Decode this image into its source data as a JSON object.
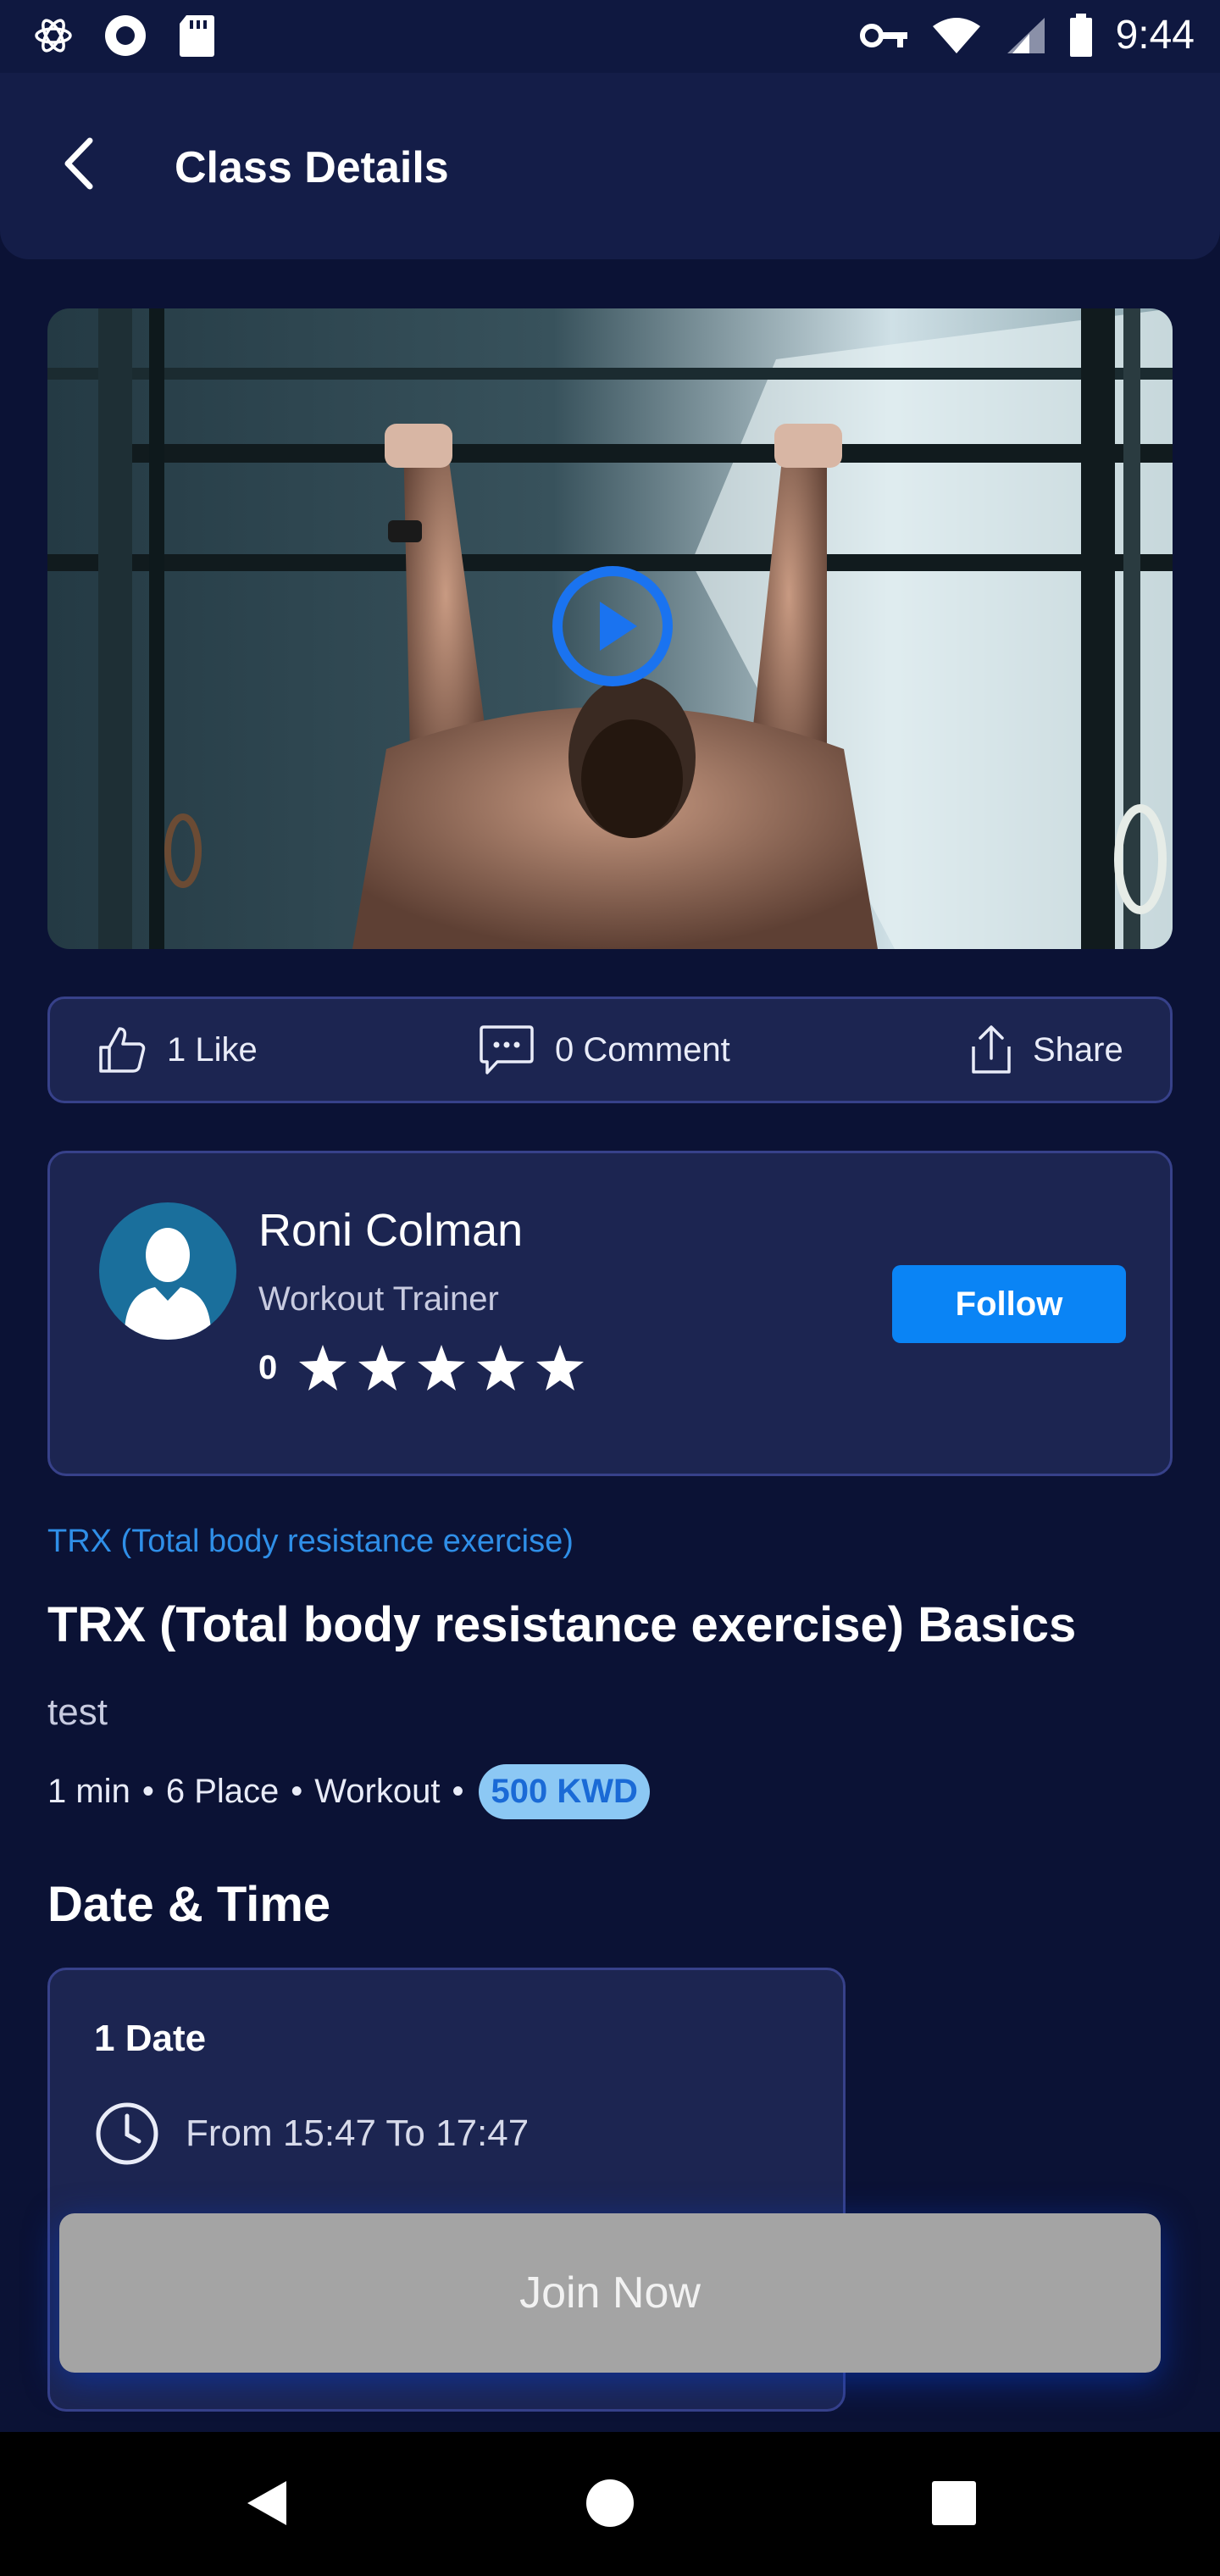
{
  "status_bar": {
    "time": "9:44",
    "icons": [
      "atom-icon",
      "record-icon",
      "sd-card-icon",
      "key-icon",
      "wifi-icon",
      "signal-icon",
      "battery-icon"
    ]
  },
  "header": {
    "title": "Class Details",
    "back_icon": "back-arrow-icon"
  },
  "video": {
    "play_icon": "play-icon",
    "accent": "#1a73f0"
  },
  "actions": {
    "like_label": "1 Like",
    "comment_label": "0 Comment",
    "share_label": "Share"
  },
  "trainer": {
    "name": "Roni Colman",
    "role": "Workout Trainer",
    "rating": "0",
    "stars": 5,
    "follow_label": "Follow",
    "follow_color": "#0a84f5"
  },
  "class": {
    "category": "TRX (Total body resistance exercise)",
    "title": "TRX (Total body resistance exercise) Basics",
    "description": "test",
    "duration": "1 min",
    "places": "6 Place",
    "type": "Workout",
    "price": "500 KWD"
  },
  "schedule": {
    "heading": "Date & Time",
    "date_label": "1 Date",
    "time_range": "From 15:47  To 17:47"
  },
  "join_label": "Join Now",
  "nav": {
    "back_icon": "nav-back-icon",
    "home_icon": "nav-home-icon",
    "recents_icon": "nav-recents-icon"
  }
}
